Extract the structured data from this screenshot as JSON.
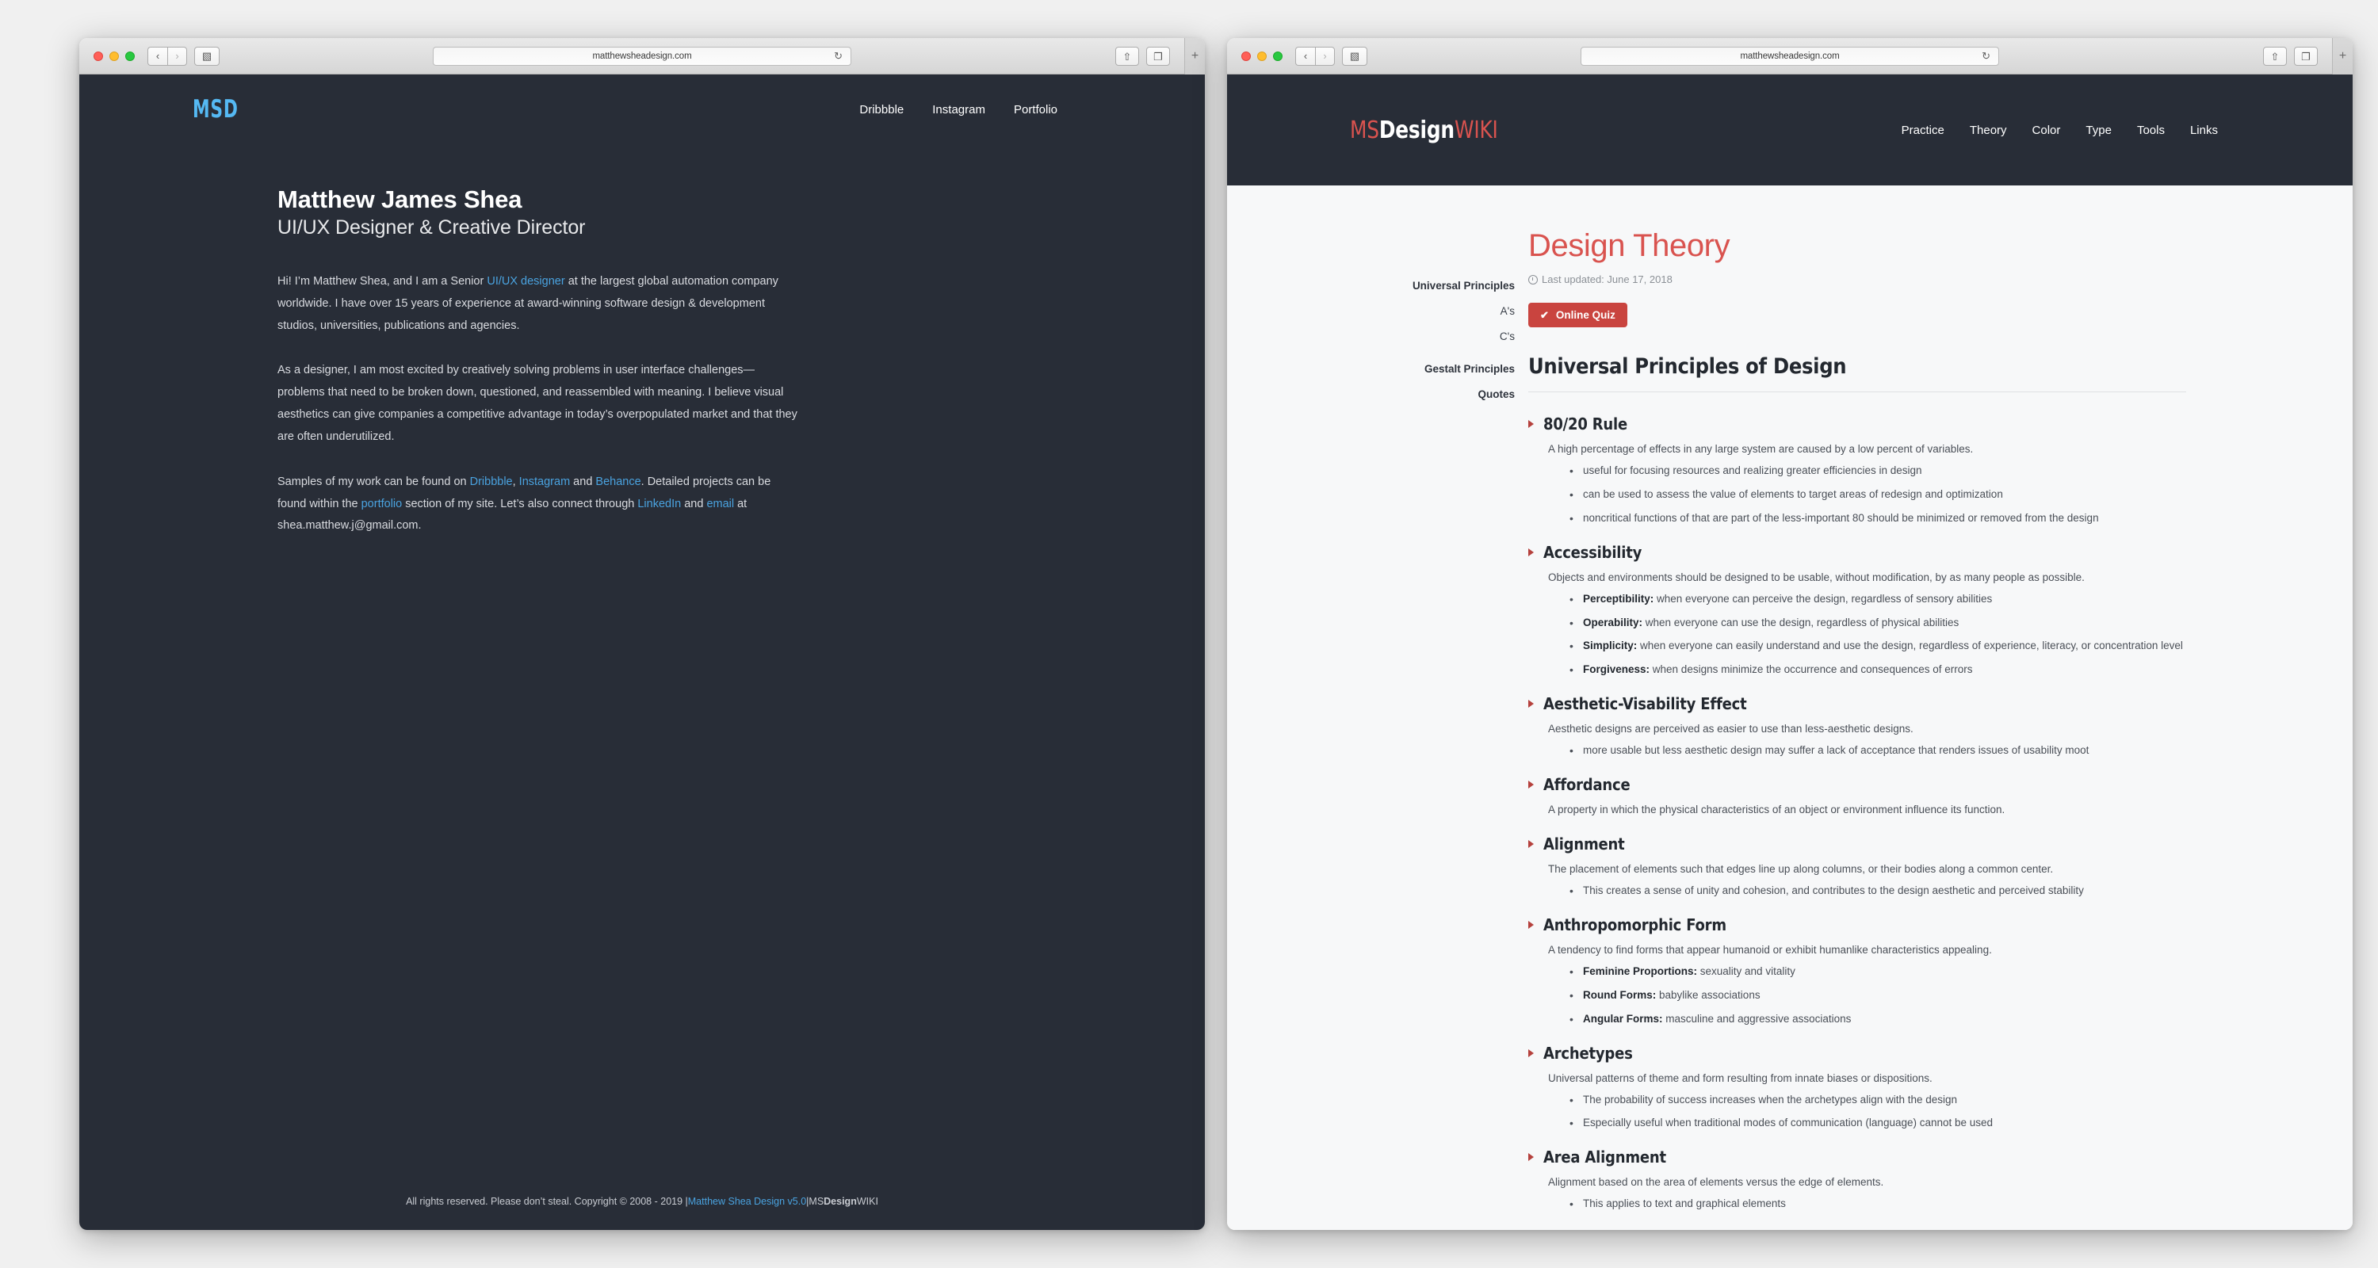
{
  "colors": {
    "dark_bg": "#282d37",
    "accent_blue": "#4aa3e0",
    "accent_red": "#d9534f",
    "quiz_red": "#c9443f",
    "wiki_bg": "#f7f8f9"
  },
  "left_window": {
    "chrome": {
      "url": "matthewsheadesign.com",
      "back_glyph": "‹",
      "forward_glyph": "›",
      "sidebar_glyph": "▧",
      "reload_glyph": "↻",
      "share_glyph": "⇧",
      "tabs_glyph": "❐",
      "newtab_glyph": "+"
    },
    "header": {
      "logo": "MSD",
      "nav": [
        {
          "label": "Dribbble"
        },
        {
          "label": "Instagram"
        },
        {
          "label": "Portfolio"
        }
      ]
    },
    "bio": {
      "name": "Matthew James Shea",
      "role": "UI/UX Designer & Creative Director",
      "para1_a": "Hi! I’m Matthew Shea, and I am a Senior ",
      "para1_link": "UI/UX designer",
      "para1_b": " at the largest global automation company worldwide. I have over 15 years of experience at award-winning software design & development studios, universities, publications and agencies.",
      "para2": "As a designer, I am most excited by creatively solving problems in user interface challenges—problems that need to be broken down, questioned, and reassembled with meaning. I believe visual aesthetics can give companies a competitive advantage in today’s overpopulated market and that they are often underutilized.",
      "para3_a": "Samples of my work can be found on ",
      "link_dribbble": "Dribbble",
      "para3_b": ", ",
      "link_instagram": "Instagram",
      "para3_c": " and ",
      "link_behance": "Behance",
      "para3_d": ". Detailed projects can be found within the ",
      "link_portfolio": "portfolio",
      "para3_e": " section of my site. Let’s also connect through ",
      "link_linkedin": "LinkedIn",
      "para3_f": " and ",
      "link_email": "email",
      "para3_g": " at shea.matthew.j@gmail.com."
    },
    "footer": {
      "text": "All rights reserved. Please don’t steal. Copyright © 2008 - 2019 | ",
      "link_site": "Matthew Shea Design v5.0",
      "separator": " | ",
      "wiki_ms": "MS",
      "wiki_design": "Design",
      "wiki_wiki": "WIKI"
    }
  },
  "right_window": {
    "chrome": {
      "url": "matthewsheadesign.com",
      "back_glyph": "‹",
      "forward_glyph": "›",
      "sidebar_glyph": "▧",
      "reload_glyph": "↻",
      "share_glyph": "⇧",
      "tabs_glyph": "❐",
      "newtab_glyph": "+"
    },
    "header": {
      "logo_ms": "MS",
      "logo_design": "Design",
      "logo_wiki": "WIKI",
      "nav": [
        {
          "label": "Practice"
        },
        {
          "label": "Theory"
        },
        {
          "label": "Color"
        },
        {
          "label": "Type"
        },
        {
          "label": "Tools"
        },
        {
          "label": "Links"
        }
      ]
    },
    "article": {
      "title": "Design Theory",
      "last_updated": "Last updated: June 17, 2018",
      "quiz_button": "Online Quiz",
      "quiz_check": "✔",
      "section_heading": "Universal Principles of Design"
    },
    "sidenav": {
      "items": [
        {
          "label": "Universal Principles",
          "sub": false
        },
        {
          "label": "A's",
          "sub": true
        },
        {
          "label": "C's",
          "sub": true
        },
        {
          "label": "Gestalt Principles",
          "sub": false,
          "gap": true
        },
        {
          "label": "Quotes",
          "sub": false
        }
      ]
    },
    "principles": [
      {
        "title": "80/20 Rule",
        "desc": "A high percentage of effects in any large system are caused by a low percent of variables.",
        "bullets": [
          {
            "text": "useful for focusing resources and realizing greater efficiencies in design"
          },
          {
            "text": "can be used to assess the value of elements to target areas of redesign and optimization"
          },
          {
            "text": "noncritical functions of that are part of the less-important 80 should be minimized or removed from the design"
          }
        ]
      },
      {
        "title": "Accessibility",
        "desc": "Objects and environments should be designed to be usable, without modification, by as many people as possible.",
        "bullets": [
          {
            "bold": "Perceptibility:",
            "text": " when everyone can perceive the design, regardless of sensory abilities"
          },
          {
            "bold": "Operability:",
            "text": " when everyone can use the design, regardless of physical abilities"
          },
          {
            "bold": "Simplicity:",
            "text": " when everyone can easily understand and use the design, regardless of experience, literacy, or concentration level"
          },
          {
            "bold": "Forgiveness:",
            "text": " when designs minimize the occurrence and consequences of errors"
          }
        ]
      },
      {
        "title": "Aesthetic-Visability Effect",
        "desc": "Aesthetic designs are perceived as easier to use than less-aesthetic designs.",
        "bullets": [
          {
            "text": "more usable but less aesthetic design may suffer a lack of acceptance that renders issues of usability moot"
          }
        ]
      },
      {
        "title": "Affordance",
        "desc": "A property in which the physical characteristics of an object or environment influence its function.",
        "bullets": []
      },
      {
        "title": "Alignment",
        "desc": "The placement of elements such that edges line up along columns, or their bodies along a common center.",
        "bullets": [
          {
            "text": "This creates a sense of unity and cohesion, and contributes to the design aesthetic and perceived stability"
          }
        ]
      },
      {
        "title": "Anthropomorphic Form",
        "desc": "A tendency to find forms that appear humanoid or exhibit humanlike characteristics appealing.",
        "bullets": [
          {
            "bold": "Feminine Proportions:",
            "text": " sexuality and vitality"
          },
          {
            "bold": "Round Forms:",
            "text": " babylike associations"
          },
          {
            "bold": "Angular Forms:",
            "text": " masculine and aggressive associations"
          }
        ]
      },
      {
        "title": "Archetypes",
        "desc": "Universal patterns of theme and form resulting from innate biases or dispositions.",
        "bullets": [
          {
            "text": "The probability of success increases when the archetypes align with the design"
          },
          {
            "text": "Especially useful when traditional modes of communication (language) cannot be used"
          }
        ]
      },
      {
        "title": "Area Alignment",
        "desc": "Alignment based on the area of elements versus the edge of elements.",
        "bullets": [
          {
            "text": "This applies to text and graphical elements"
          }
        ]
      }
    ]
  }
}
